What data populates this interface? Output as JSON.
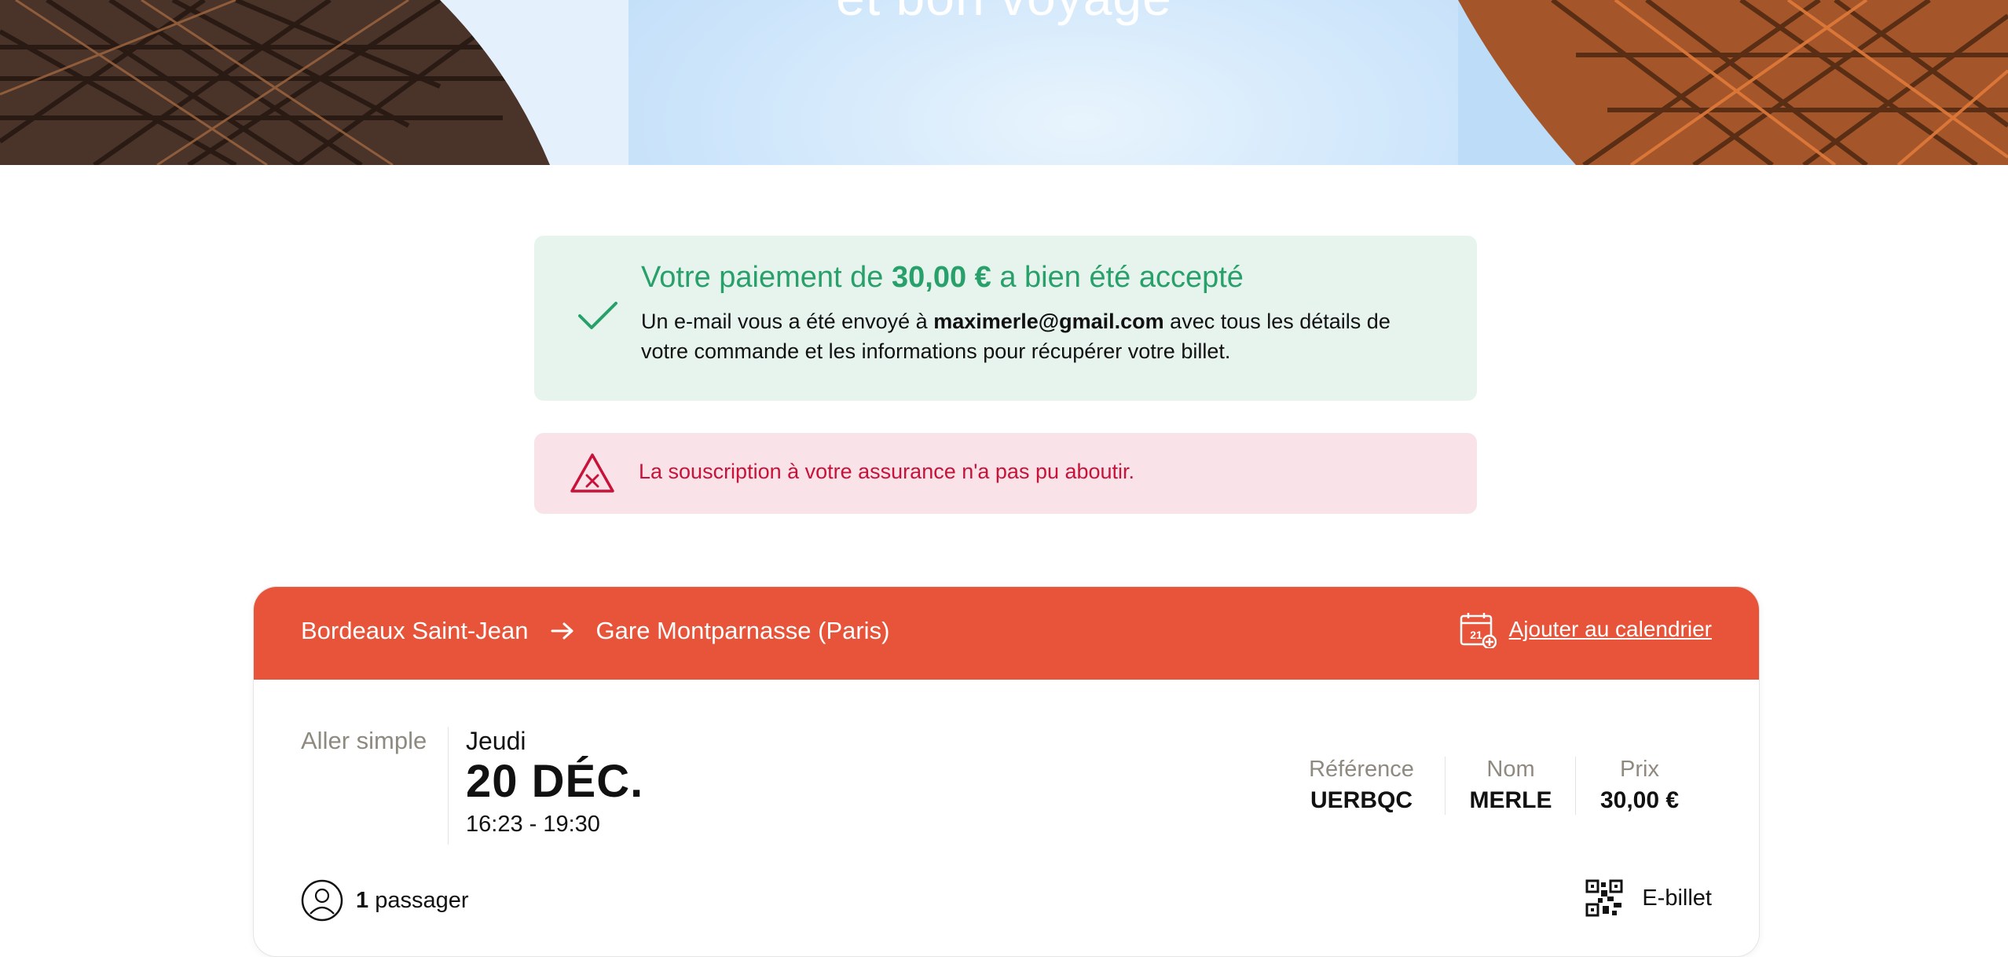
{
  "hero": {
    "title": "et bon voyage"
  },
  "payment_success": {
    "title_prefix": "Votre paiement de ",
    "amount": "30,00 €",
    "title_suffix": " a bien été accepté",
    "text_prefix": "Un e-mail vous a été envoyé à ",
    "email": "maximerle@gmail.com",
    "text_suffix": " avec tous les détails de votre commande et les informations pour récupérer votre billet.",
    "icon": "checkmark-icon"
  },
  "insurance_error": {
    "text": "La souscription à votre assurance n'a pas pu aboutir.",
    "icon": "warning-triangle-icon"
  },
  "trip": {
    "origin": "Bordeaux Saint-Jean",
    "destination": "Gare Montparnasse (Paris)",
    "calendar_link": "Ajouter au calendrier",
    "calendar_icon_day": "21",
    "trip_type": "Aller simple",
    "day": "Jeudi",
    "date": "20 DÉC.",
    "time": "16:23 - 19:30",
    "reference_label": "Référence",
    "reference": "UERBQC",
    "name_label": "Nom",
    "name": "MERLE",
    "price_label": "Prix",
    "price": "30,00 €",
    "passenger_count": "1",
    "passenger_label": " passager",
    "ticket_type": "E-billet"
  },
  "colors": {
    "accent": "#e8543a",
    "success": "#27a06a",
    "success_bg": "#e7f4ee",
    "error": "#c7123a",
    "error_bg": "#fae3e8",
    "muted": "#8f8a80"
  }
}
